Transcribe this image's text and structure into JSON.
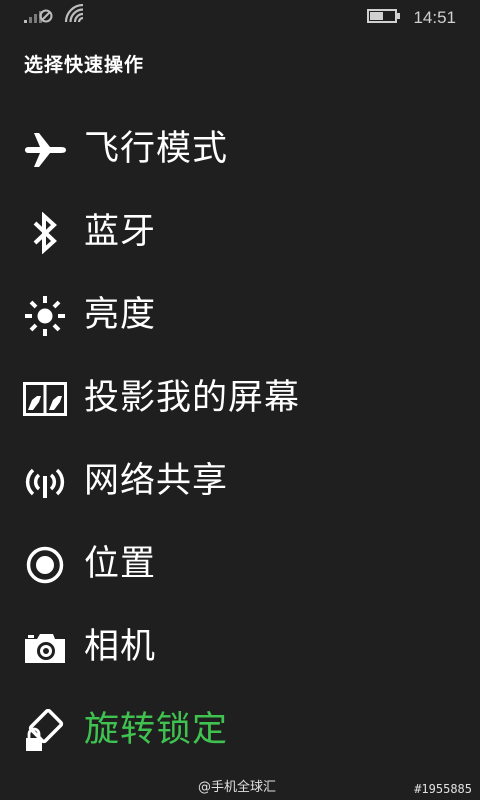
{
  "status": {
    "time": "14:51",
    "icons": [
      "no-sim-signal-icon",
      "wifi-icon",
      "battery-icon"
    ],
    "battery_level": 0.55
  },
  "page": {
    "title": "选择快速操作"
  },
  "actions": [
    {
      "label": "飞行模式",
      "icon": "airplane-icon"
    },
    {
      "label": "蓝牙",
      "icon": "bluetooth-icon"
    },
    {
      "label": "亮度",
      "icon": "brightness-icon"
    },
    {
      "label": "投影我的屏幕",
      "icon": "project-screen-icon"
    },
    {
      "label": "网络共享",
      "icon": "hotspot-icon"
    },
    {
      "label": "位置",
      "icon": "location-icon"
    },
    {
      "label": "相机",
      "icon": "camera-icon"
    },
    {
      "label": "旋转锁定",
      "icon": "rotation-lock-icon"
    }
  ],
  "colors": {
    "background": "#1f1f1f",
    "text": "#ffffff",
    "accent": "#3fc24f"
  },
  "watermark": "@手机全球汇",
  "tag": "#1955885"
}
